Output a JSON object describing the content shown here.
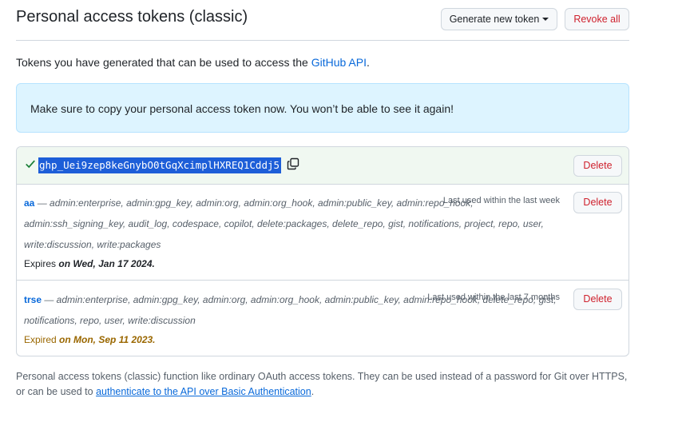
{
  "header": {
    "title": "Personal access tokens (classic)",
    "generate_label": "Generate new token",
    "revoke_label": "Revoke all"
  },
  "intro": {
    "text": "Tokens you have generated that can be used to access the ",
    "link": "GitHub API",
    "suffix": "."
  },
  "flash": {
    "text": "Make sure to copy your personal access token now. You won’t be able to see it again!"
  },
  "new_token": {
    "value": "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",
    "delete_label": "Delete"
  },
  "tokens": [
    {
      "name": "aa",
      "scopes": " — admin:enterprise, admin:gpg_key, admin:org, admin:org_hook, admin:public_key, admin:repo_hook, admin:ssh_signing_key, audit_log, codespace, copilot, delete:packages, delete_repo, gist, notifications, project, repo, user, write:discussion, write:packages",
      "last_used": "Last used within the last week",
      "expires_prefix": "Expires ",
      "expires_date": "on Wed, Jan 17 2024.",
      "delete_label": "Delete"
    },
    {
      "name": "trse",
      "scopes": " — admin:enterprise, admin:gpg_key, admin:org, admin:org_hook, admin:public_key, admin:repo_hook, delete_repo, gist, notifications, repo, user, write:discussion",
      "last_used": "Last used within the last 7 months",
      "expires_prefix": "Expired ",
      "expires_date": "on Mon, Sep 11 2023.",
      "delete_label": "Delete"
    }
  ],
  "footer": {
    "text": "Personal access tokens (classic) function like ordinary OAuth access tokens. They can be used instead of a password for Git over HTTPS, or can be used to ",
    "link": "authenticate to the API over Basic Authentication",
    "suffix": "."
  }
}
